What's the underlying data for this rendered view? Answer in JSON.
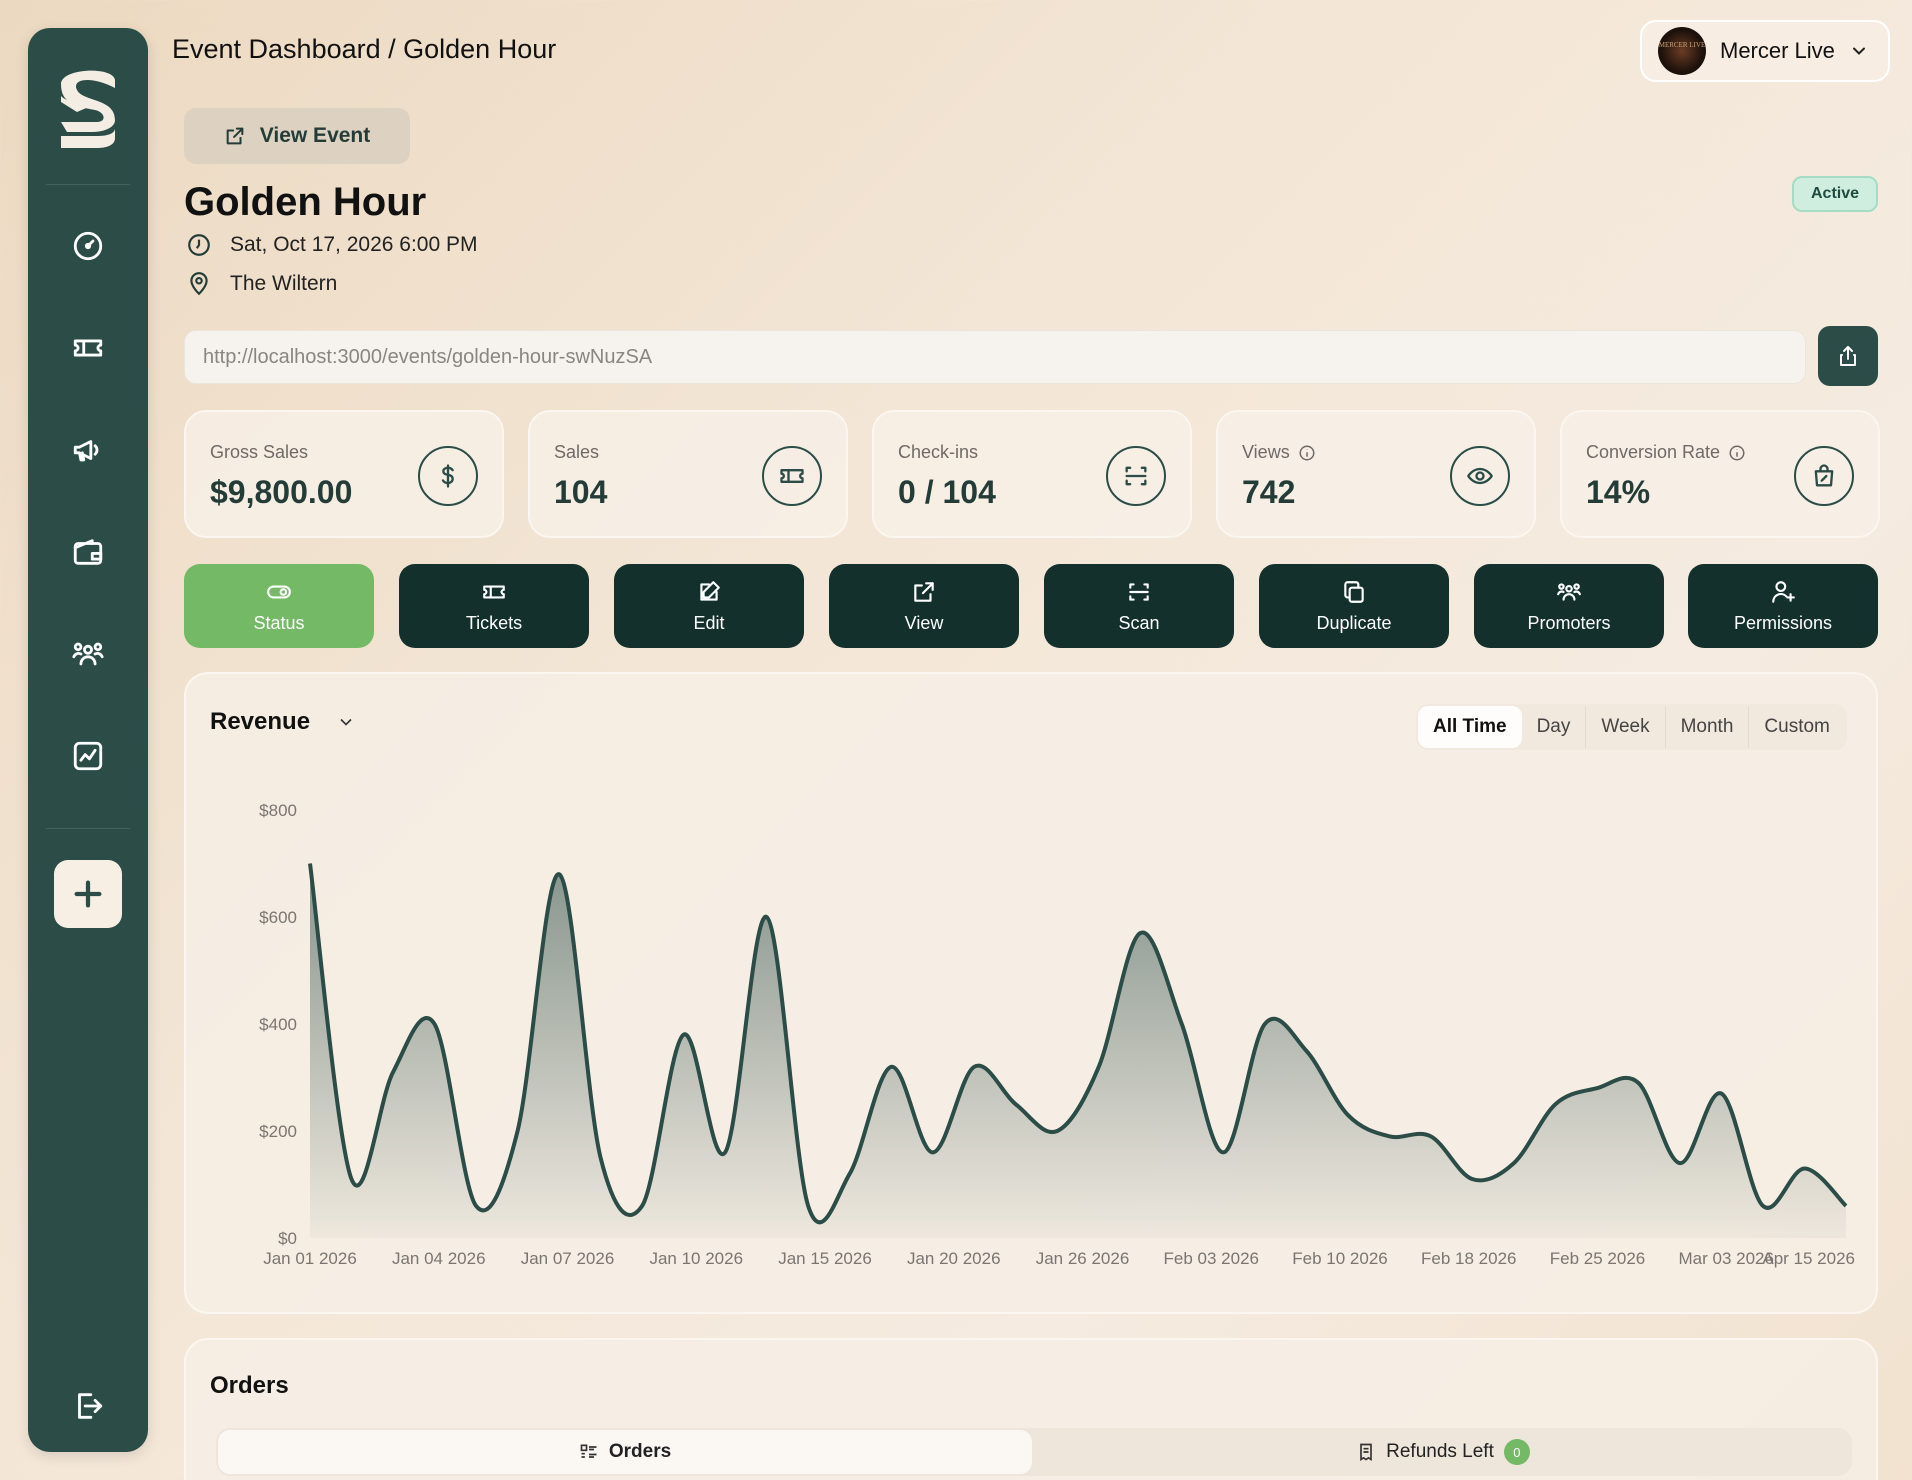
{
  "header": {
    "breadcrumb": "Event Dashboard / Golden Hour",
    "account_name": "Mercer Live",
    "avatar_text": "MERCER LIVE"
  },
  "sidebar": {
    "items": [
      {
        "icon": "gauge-icon"
      },
      {
        "icon": "ticket-icon"
      },
      {
        "icon": "megaphone-icon"
      },
      {
        "icon": "wallet-icon"
      },
      {
        "icon": "users-icon"
      },
      {
        "icon": "analytics-icon"
      }
    ],
    "add_icon": "plus-icon",
    "logout_icon": "logout-icon"
  },
  "event": {
    "view_event_label": "View Event",
    "title": "Golden Hour",
    "status": "Active",
    "datetime": "Sat, Oct 17, 2026 6:00 PM",
    "venue": "The Wiltern",
    "url": "http://localhost:3000/events/golden-hour-swNuzSA"
  },
  "stats": [
    {
      "label": "Gross Sales",
      "value": "$9,800.00",
      "icon": "dollar-icon"
    },
    {
      "label": "Sales",
      "value": "104",
      "icon": "ticket-icon"
    },
    {
      "label": "Check-ins",
      "value": "0 / 104",
      "icon": "scan-icon"
    },
    {
      "label": "Views",
      "value": "742",
      "icon": "eye-icon"
    },
    {
      "label": "Conversion Rate",
      "value": "14%",
      "icon": "bag-percent-icon"
    }
  ],
  "actions": [
    {
      "label": "Status",
      "icon": "toggle-icon"
    },
    {
      "label": "Tickets",
      "icon": "ticket-icon"
    },
    {
      "label": "Edit",
      "icon": "edit-icon"
    },
    {
      "label": "View",
      "icon": "external-link-icon"
    },
    {
      "label": "Scan",
      "icon": "scan-icon"
    },
    {
      "label": "Duplicate",
      "icon": "copy-icon"
    },
    {
      "label": "Promoters",
      "icon": "users-icon"
    },
    {
      "label": "Permissions",
      "icon": "user-plus-icon"
    }
  ],
  "colors": {
    "sidebar": "#2b4c47",
    "action_dark": "#13302c",
    "status_green": "#74ba66",
    "line": "#2b4c47"
  },
  "revenue": {
    "title": "Revenue",
    "ranges": [
      "All Time",
      "Day",
      "Week",
      "Month",
      "Custom"
    ],
    "selected_range": "All Time"
  },
  "chart_data": {
    "type": "area",
    "ylim": [
      0,
      800
    ],
    "y_ticks": [
      "$0",
      "$200",
      "$400",
      "$600",
      "$800"
    ],
    "x_tick_labels": [
      "Jan 01 2026",
      "Jan 04 2026",
      "Jan 07 2026",
      "Jan 10 2026",
      "Jan 15 2026",
      "Jan 20 2026",
      "Jan 26 2026",
      "Feb 03 2026",
      "Feb 10 2026",
      "Feb 18 2026",
      "Feb 25 2026",
      "Mar 03 2026",
      "Apr 15 2026"
    ],
    "values": [
      700,
      110,
      310,
      400,
      60,
      200,
      680,
      150,
      60,
      380,
      160,
      600,
      60,
      120,
      320,
      160,
      320,
      250,
      200,
      320,
      570,
      400,
      160,
      400,
      350,
      230,
      190,
      190,
      110,
      140,
      250,
      280,
      290,
      140,
      270,
      60,
      130,
      60
    ]
  },
  "orders": {
    "title": "Orders",
    "tab_orders": "Orders",
    "tab_refunds": "Refunds Left",
    "refunds_count": "0"
  }
}
